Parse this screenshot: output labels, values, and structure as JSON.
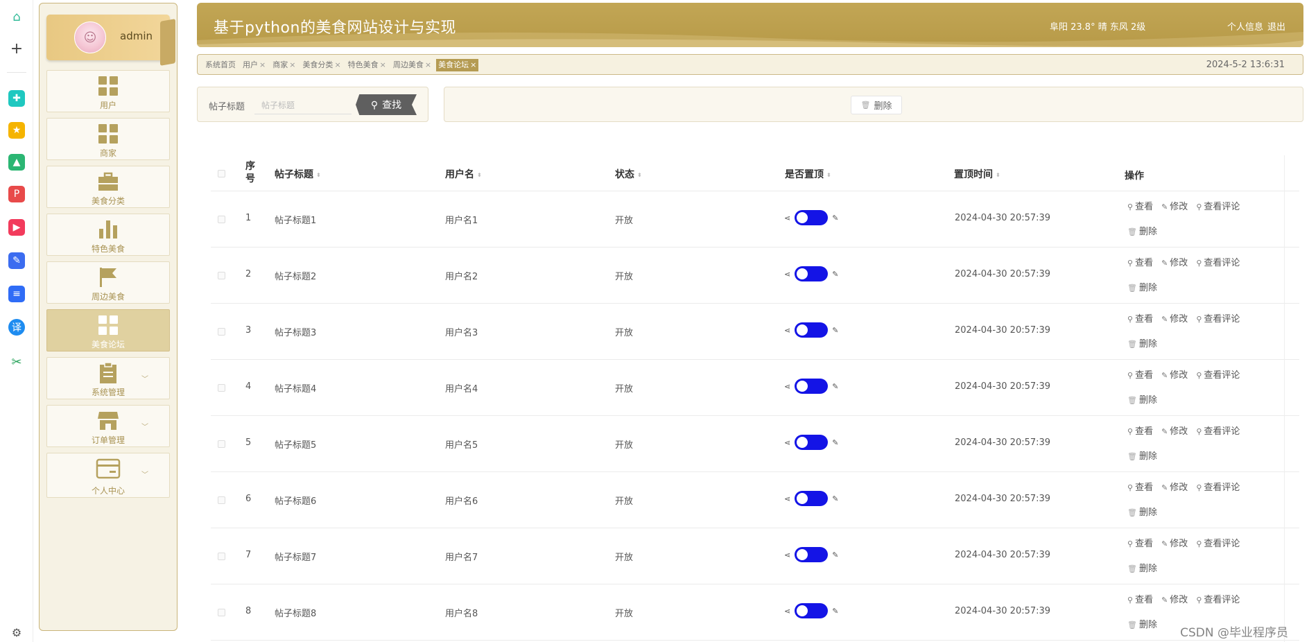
{
  "app": {
    "title": "基于python的美食网站设计与实现",
    "weather": "阜阳 23.8° 晴 东风 2级",
    "links": [
      "个人信息",
      "退出"
    ],
    "datetime": "2024-5-2 13:6:31"
  },
  "user": {
    "name": "admin"
  },
  "browser_icons": [
    "home-icon",
    "plus-icon",
    "app-teal-icon",
    "star-icon",
    "image-ai-icon",
    "pdf-ai-icon",
    "video-ai-icon",
    "edit-ai-icon",
    "doc-ai-icon",
    "translate-icon",
    "scissors-icon",
    "settings-icon"
  ],
  "sidebar": {
    "items": [
      {
        "label": "用户",
        "icon": "grid-icon"
      },
      {
        "label": "商家",
        "icon": "grid-icon"
      },
      {
        "label": "美食分类",
        "icon": "briefcase-icon"
      },
      {
        "label": "特色美食",
        "icon": "bar-chart-icon"
      },
      {
        "label": "周边美食",
        "icon": "flag-icon"
      },
      {
        "label": "美食论坛",
        "icon": "grid-icon",
        "active": true
      },
      {
        "label": "系统管理",
        "icon": "clipboard-icon",
        "expandable": true
      },
      {
        "label": "订单管理",
        "icon": "store-icon",
        "expandable": true
      },
      {
        "label": "个人中心",
        "icon": "card-icon",
        "expandable": true
      }
    ]
  },
  "tabs": [
    {
      "label": "系统首页",
      "closable": false
    },
    {
      "label": "用户",
      "closable": true
    },
    {
      "label": "商家",
      "closable": true
    },
    {
      "label": "美食分类",
      "closable": true
    },
    {
      "label": "特色美食",
      "closable": true
    },
    {
      "label": "周边美食",
      "closable": true
    },
    {
      "label": "美食论坛",
      "closable": true,
      "active": true
    }
  ],
  "search": {
    "label": "帖子标题",
    "placeholder": "帖子标题",
    "button": "查找"
  },
  "actions": {
    "delete": "删除"
  },
  "table": {
    "columns": [
      "序号",
      "帖子标题",
      "用户名",
      "状态",
      "是否置顶",
      "置顶时间",
      "操作"
    ],
    "ops": [
      "查看",
      "修改",
      "查看评论",
      "删除"
    ],
    "rows": [
      {
        "index": "1",
        "title": "帖子标题1",
        "user": "用户名1",
        "status": "开放",
        "pinned": true,
        "time": "2024-04-30 20:57:39"
      },
      {
        "index": "2",
        "title": "帖子标题2",
        "user": "用户名2",
        "status": "开放",
        "pinned": true,
        "time": "2024-04-30 20:57:39"
      },
      {
        "index": "3",
        "title": "帖子标题3",
        "user": "用户名3",
        "status": "开放",
        "pinned": true,
        "time": "2024-04-30 20:57:39"
      },
      {
        "index": "4",
        "title": "帖子标题4",
        "user": "用户名4",
        "status": "开放",
        "pinned": true,
        "time": "2024-04-30 20:57:39"
      },
      {
        "index": "5",
        "title": "帖子标题5",
        "user": "用户名5",
        "status": "开放",
        "pinned": true,
        "time": "2024-04-30 20:57:39"
      },
      {
        "index": "6",
        "title": "帖子标题6",
        "user": "用户名6",
        "status": "开放",
        "pinned": true,
        "time": "2024-04-30 20:57:39"
      },
      {
        "index": "7",
        "title": "帖子标题7",
        "user": "用户名7",
        "status": "开放",
        "pinned": true,
        "time": "2024-04-30 20:57:39"
      },
      {
        "index": "8",
        "title": "帖子标题8",
        "user": "用户名8",
        "status": "开放",
        "pinned": true,
        "time": "2024-04-30 20:57:39"
      }
    ]
  },
  "watermark": "CSDN @毕业程序员",
  "colors": {
    "accent": "#b59b52",
    "toggle": "#1414e6",
    "sidebar_bg": "#f6f2e4"
  }
}
